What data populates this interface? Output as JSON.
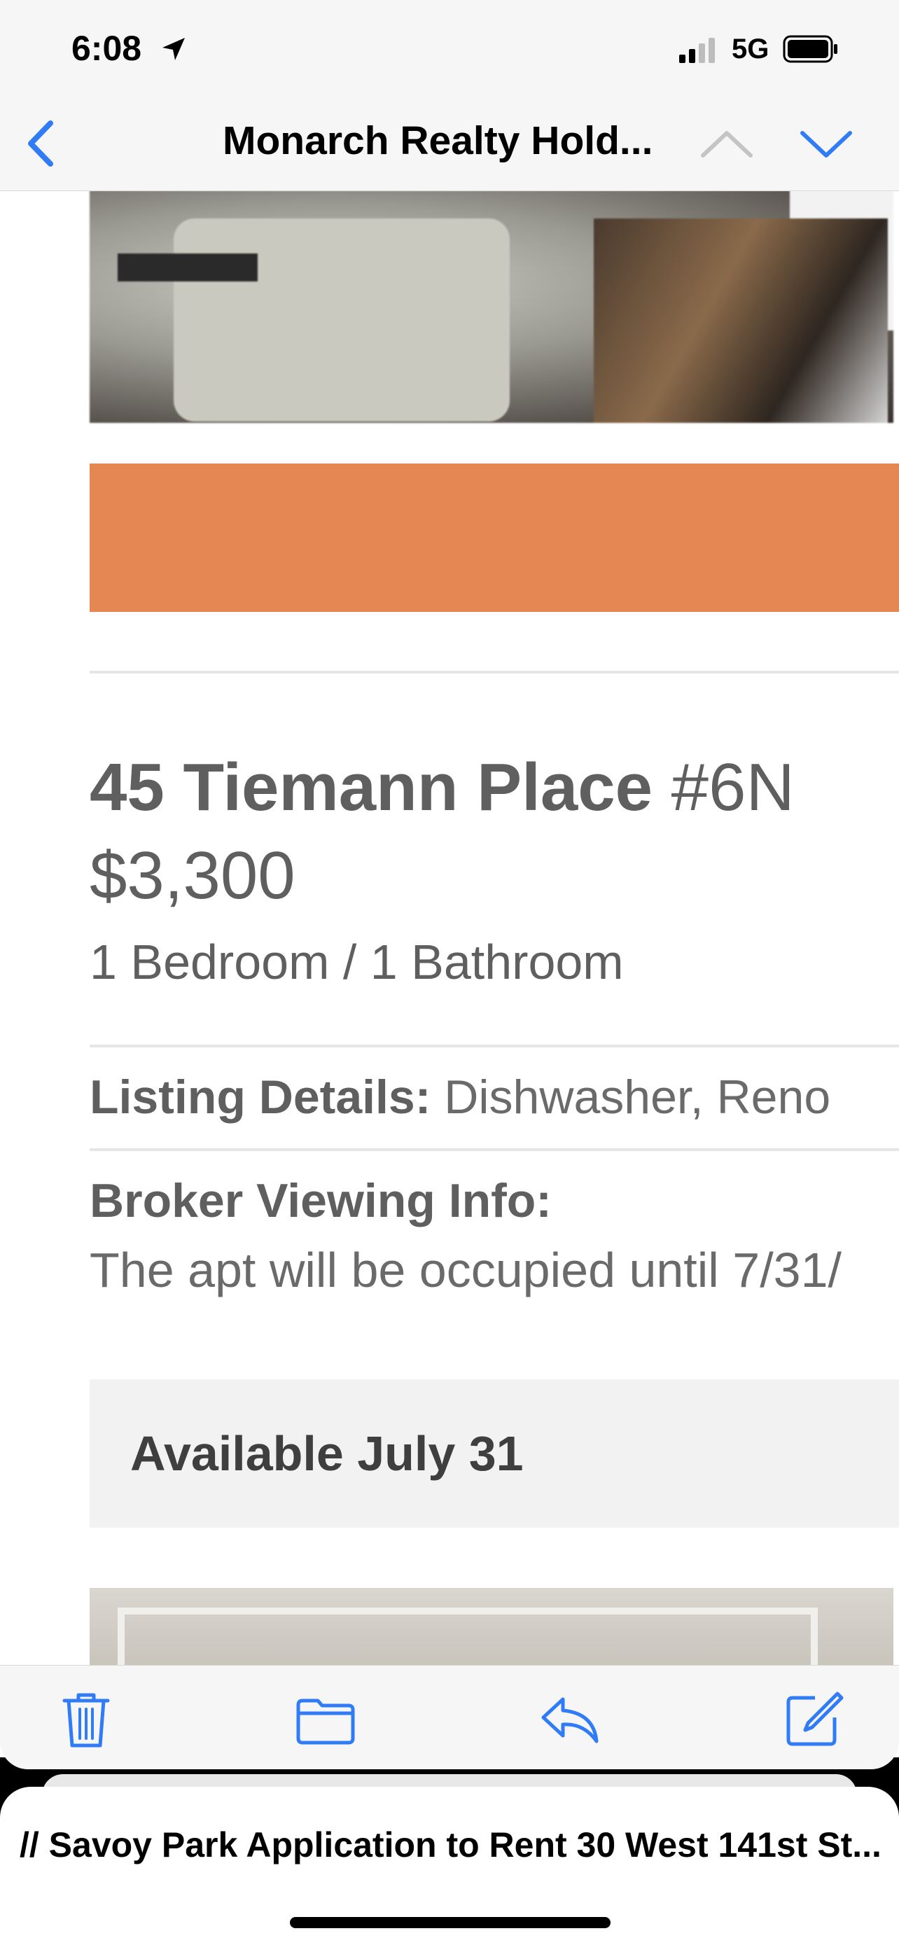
{
  "status_bar": {
    "time": "6:08",
    "network": "5G"
  },
  "nav": {
    "title": "Monarch Realty Hold...",
    "icons": [
      "back-chevron-icon",
      "up-chevron-icon",
      "down-chevron-icon"
    ],
    "accent_color": "#2f7cf6"
  },
  "listing": {
    "street": "45 Tiemann Place",
    "unit": "#6N",
    "price": "$3,300",
    "beds_baths": "1 Bedroom / 1 Bathroom",
    "details_label": "Listing Details:",
    "details_value": "Dishwasher, Reno",
    "viewing_label": "Broker Viewing Info:",
    "viewing_text": "The apt will be occupied until 7/31/",
    "available": "Available July 31",
    "banner_color": "#e58752"
  },
  "toolbar": {
    "icons": [
      "trash-icon",
      "folder-icon",
      "reply-icon",
      "compose-icon"
    ]
  },
  "draft": {
    "title": "// Savoy Park Application to Rent 30 West 141st St..."
  }
}
